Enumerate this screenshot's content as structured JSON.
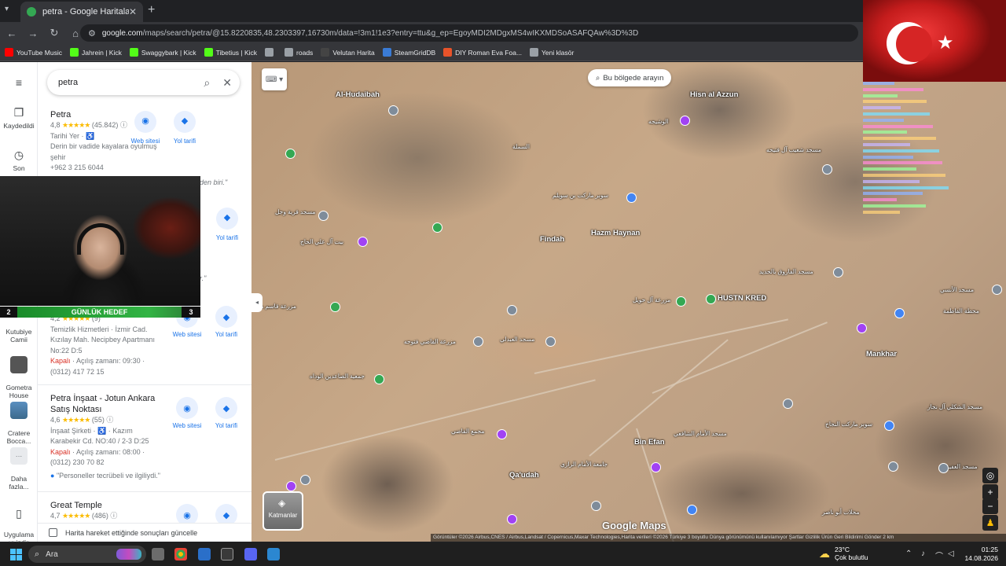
{
  "browser": {
    "tab_title": "petra - Google Haritalar",
    "tab_close": "✕",
    "new_tab": "+",
    "url_host": "google.com",
    "url_rest": "/maps/search/petra/@15.8220835,48.2303397,16730m/data=!3m1!1e3?entry=ttu&g_ep=EgoyMDI2MDgxMS4wIKXMDSoASAFQAw%3D%3D",
    "bookmarks": [
      {
        "label": "YouTube Music",
        "color": "#ff0000"
      },
      {
        "label": "Jahrein | Kick",
        "color": "#53fc18"
      },
      {
        "label": "Swaggybark | Kick",
        "color": "#53fc18"
      },
      {
        "label": "Tibetius | Kick",
        "color": "#53fc18"
      },
      {
        "label": "",
        "color": "#9aa0a6"
      },
      {
        "label": "roads",
        "color": "#9aa0a6"
      },
      {
        "label": "Velutan Harita",
        "color": "#444444"
      },
      {
        "label": "SteamGridDB",
        "color": "#3a7bd5"
      },
      {
        "label": "DIY Roman Eva Foa...",
        "color": "#e8532a"
      },
      {
        "label": "Yeni klasör",
        "color": "#9aa0a6"
      }
    ]
  },
  "rail": {
    "menu_icon": "≡",
    "saved": "Kaydedildi",
    "recent": "Son",
    "kutubiye": "Kutubiye\nCamii",
    "gometra": "Gometra\nHouse",
    "cratere": "Cratere\nBocca...",
    "more": "Daha\nfazla...",
    "install": "Uygulama\nyı indir"
  },
  "search": {
    "query": "petra"
  },
  "results": [
    {
      "name": "Petra",
      "rating": "4,8",
      "stars": "★★★★★",
      "count": "(45.842)",
      "type": "Tarihi Yer · ♿",
      "desc1": "Derin bir vadide kayalara oyulmuş",
      "desc2": "şehir",
      "phone": "+962 3 215 6044",
      "website": "Web sitesi",
      "directions": "Yol tarifi"
    },
    {
      "partial_quote": "den biri.\"",
      "partial_quote2": "r.\"",
      "directions": "Yol tarifi"
    },
    {
      "rating": "4,2",
      "stars": "★★★★★",
      "count": "(9)",
      "type": "Temizlik Hizmetleri · İzmir Cad.",
      "addr1": "Kızılay Mah. Necipbey Apartmanı",
      "addr2": "No:22 D:5",
      "status": "Kapalı",
      "hours": " · Açılış zamanı: 09:30 ·",
      "phone": "(0312) 417 72 15",
      "website": "Web sitesi",
      "directions": "Yol tarifi"
    },
    {
      "name": "Petra İnşaat - Jotun Ankara Satış Noktası",
      "rating": "4,6",
      "stars": "★★★★★",
      "count": "(55)",
      "type": "İnşaat Şirketi · ♿ · Kazım",
      "addr": "Karabekir Cd. NO:40 / 2-3 D:25",
      "status": "Kapalı",
      "hours": " · Açılış zamanı: 08:00 ·",
      "phone": "(0312) 230 70 82",
      "review": "\"Personeller tecrübeli ve ilgiliydi.\"",
      "website": "Web sitesi",
      "directions": "Yol tarifi"
    },
    {
      "name": "Great Temple",
      "rating": "4,7",
      "stars": "★★★★★",
      "count": "(486)"
    }
  ],
  "update_checkbox": "Harita hareket ettiğinde sonuçları güncelle",
  "map": {
    "search_area": "Bu bölgede arayın",
    "layers": "Katmanlar",
    "google_logo": "Google Maps",
    "attribution": "Görüntüler ©2026 Airbus,CNES / Airbus,Landsat / Copernicus,Maxar Technologies,Harita verileri ©2026   Türkiye   3 boyutlu Dünya görünümünü kullanılamıyor   Şartlar   Gizlilik   Ürün Geri Bildirimi Gönder   2 km",
    "labels": [
      {
        "t": "Al-Hudaibah",
        "cls": ""
      },
      {
        "t": "Hisn al Azzun",
        "cls": ""
      },
      {
        "t": "Findah",
        "cls": ""
      },
      {
        "t": "Hazm Haynan",
        "cls": ""
      },
      {
        "t": "Mankhar",
        "cls": ""
      },
      {
        "t": "Bin Efan",
        "cls": ""
      },
      {
        "t": "Qa'udah",
        "cls": ""
      },
      {
        "t": "الوشيجه",
        "cls": "sm"
      },
      {
        "t": "السملة",
        "cls": "sm"
      },
      {
        "t": "مسجد قرية وجل",
        "cls": "sm"
      },
      {
        "t": "بيت آل علي الحاج",
        "cls": "sm"
      },
      {
        "t": "مزرعة قاسم محسن",
        "cls": "sm"
      },
      {
        "t": "مزرعة القاضي فتوحه",
        "cls": "sm"
      },
      {
        "t": "جمعية الصاعدين الوداه",
        "cls": "sm"
      },
      {
        "t": "مجمع الفاضي",
        "cls": "sm"
      },
      {
        "t": "مسجد العبدلي",
        "cls": "sm"
      },
      {
        "t": "HUSTN KRED",
        "cls": ""
      },
      {
        "t": "مسجد الفاروق بالحديد",
        "cls": "sm"
      },
      {
        "t": "مسجد شعيب آل فتيحه",
        "cls": "sm"
      },
      {
        "t": "سوبر ماركت بن سويلم",
        "cls": "sm"
      },
      {
        "t": "مسجد الأمام الشافعي",
        "cls": "sm"
      },
      {
        "t": "سوبر ماركت النجاح",
        "cls": "sm"
      },
      {
        "t": "مسجد الشكلي آل نجار",
        "cls": "sm"
      },
      {
        "t": "مسجد العفيدة",
        "cls": "sm"
      },
      {
        "t": "محلات أبو ناصر",
        "cls": "sm"
      },
      {
        "t": "جامعة الأمام الرازي",
        "cls": "sm"
      },
      {
        "t": "مزرعة آل حويل",
        "cls": "sm"
      },
      {
        "t": "محطة الفاطمة",
        "cls": "sm"
      },
      {
        "t": "مسجد الأنسي",
        "cls": "sm"
      }
    ]
  },
  "overlay": {
    "goal_left": "2",
    "goal_label": "GÜNLÜK HEDEF",
    "goal_right": "3",
    "chat_lines": 22
  },
  "taskbar": {
    "search_label": "Ara",
    "temp": "23°C",
    "weather": "Çok bulutlu",
    "time": "01:25",
    "date": "14.08.2026"
  }
}
